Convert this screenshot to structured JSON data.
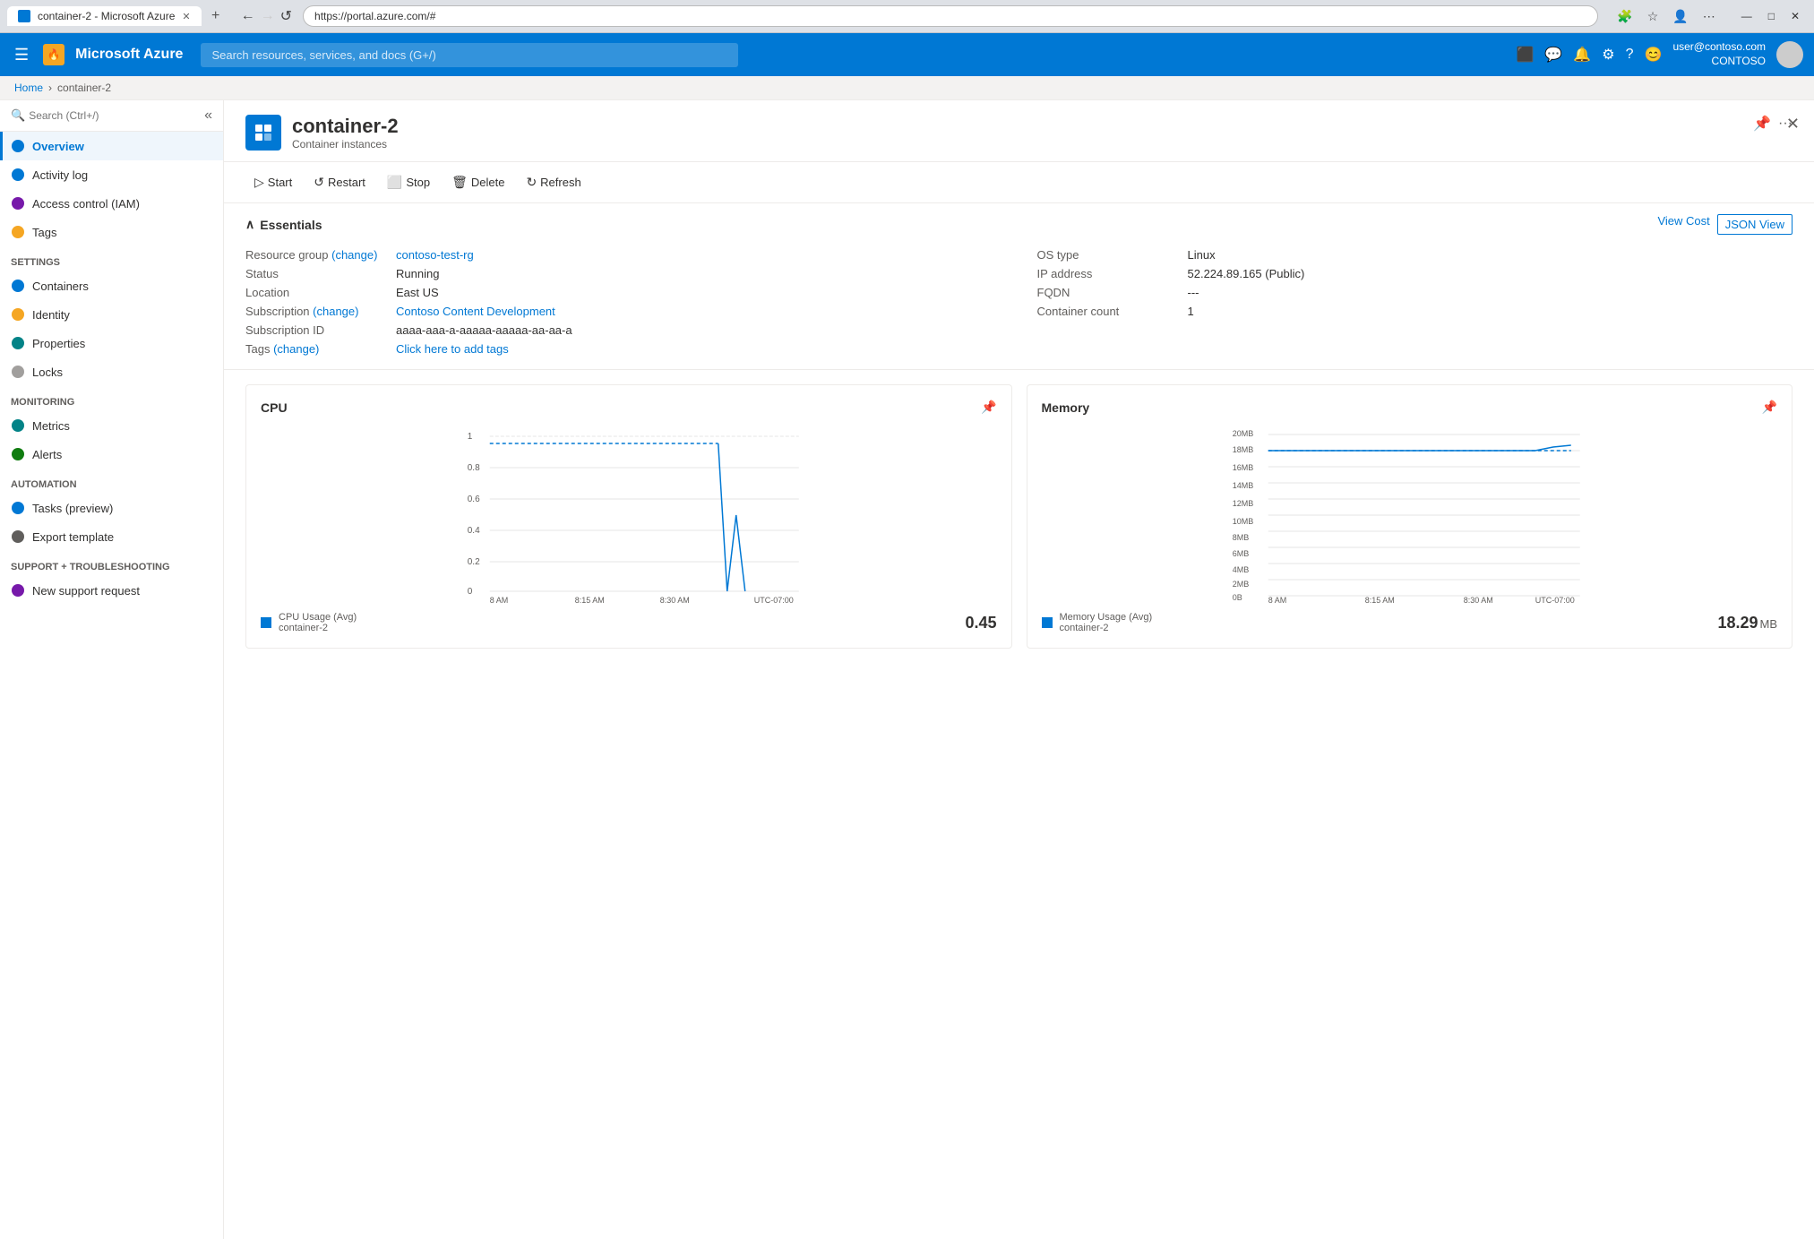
{
  "browser": {
    "tab_title": "container-2 - Microsoft Azure",
    "url": "https://portal.azure.com/#",
    "new_tab_label": "+",
    "back_label": "←",
    "forward_label": "→",
    "refresh_label": "↺",
    "minimize": "—",
    "maximize": "□",
    "close_win": "✕"
  },
  "topbar": {
    "logo": "Microsoft Azure",
    "logo_icon": "🔥",
    "search_placeholder": "Search resources, services, and docs (G+/)",
    "user_name": "user@contoso.com",
    "user_org": "CONTOSO"
  },
  "breadcrumb": {
    "home": "Home",
    "current": "container-2"
  },
  "sidebar": {
    "search_placeholder": "Search (Ctrl+/)",
    "items": [
      {
        "id": "overview",
        "label": "Overview",
        "icon": "overview",
        "active": true
      },
      {
        "id": "activity-log",
        "label": "Activity log",
        "icon": "activity"
      },
      {
        "id": "access-control",
        "label": "Access control (IAM)",
        "icon": "iam"
      },
      {
        "id": "tags",
        "label": "Tags",
        "icon": "tags"
      }
    ],
    "sections": [
      {
        "label": "Settings",
        "items": [
          {
            "id": "containers",
            "label": "Containers",
            "icon": "containers"
          },
          {
            "id": "identity",
            "label": "Identity",
            "icon": "identity"
          },
          {
            "id": "properties",
            "label": "Properties",
            "icon": "properties"
          },
          {
            "id": "locks",
            "label": "Locks",
            "icon": "locks"
          }
        ]
      },
      {
        "label": "Monitoring",
        "items": [
          {
            "id": "metrics",
            "label": "Metrics",
            "icon": "metrics"
          },
          {
            "id": "alerts",
            "label": "Alerts",
            "icon": "alerts"
          }
        ]
      },
      {
        "label": "Automation",
        "items": [
          {
            "id": "tasks",
            "label": "Tasks (preview)",
            "icon": "tasks"
          },
          {
            "id": "export",
            "label": "Export template",
            "icon": "export"
          }
        ]
      },
      {
        "label": "Support + troubleshooting",
        "items": [
          {
            "id": "support",
            "label": "New support request",
            "icon": "support"
          }
        ]
      }
    ]
  },
  "resource": {
    "title": "container-2",
    "subtitle": "Container instances",
    "icon_color": "#0078d4"
  },
  "toolbar": {
    "start_label": "Start",
    "restart_label": "Restart",
    "stop_label": "Stop",
    "delete_label": "Delete",
    "refresh_label": "Refresh"
  },
  "essentials": {
    "title": "Essentials",
    "view_cost_label": "View Cost",
    "json_view_label": "JSON View",
    "fields_left": [
      {
        "key": "Resource group (change)",
        "value": "contoso-test-rg",
        "link": true
      },
      {
        "key": "Status",
        "value": "Running"
      },
      {
        "key": "Location",
        "value": "East US"
      },
      {
        "key": "Subscription (change)",
        "value": "Contoso Content Development",
        "link": true
      },
      {
        "key": "Subscription ID",
        "value": "aaaa-aaa-a-aaaaa-aaaaa-aa-aa-a"
      },
      {
        "key": "Tags (change)",
        "value": "Click here to add tags",
        "link": true
      }
    ],
    "fields_right": [
      {
        "key": "OS type",
        "value": "Linux"
      },
      {
        "key": "IP address",
        "value": "52.224.89.165 (Public)"
      },
      {
        "key": "FQDN",
        "value": "---"
      },
      {
        "key": "Container count",
        "value": "1"
      }
    ]
  },
  "charts": {
    "cpu": {
      "title": "CPU",
      "legend_label": "CPU Usage (Avg)",
      "legend_sub": "container-2",
      "value": "0.45",
      "unit": "",
      "y_labels": [
        "1",
        "0.8",
        "0.6",
        "0.4",
        "0.2",
        "0"
      ],
      "x_labels": [
        "8 AM",
        "8:15 AM",
        "8:30 AM",
        "UTC-07:00"
      ]
    },
    "memory": {
      "title": "Memory",
      "legend_label": "Memory Usage (Avg)",
      "legend_sub": "container-2",
      "value": "18.29",
      "unit": "MB",
      "y_labels": [
        "20MB",
        "18MB",
        "16MB",
        "14MB",
        "12MB",
        "10MB",
        "8MB",
        "6MB",
        "4MB",
        "2MB",
        "0B"
      ],
      "x_labels": [
        "8 AM",
        "8:15 AM",
        "8:30 AM",
        "UTC-07:00"
      ]
    }
  }
}
